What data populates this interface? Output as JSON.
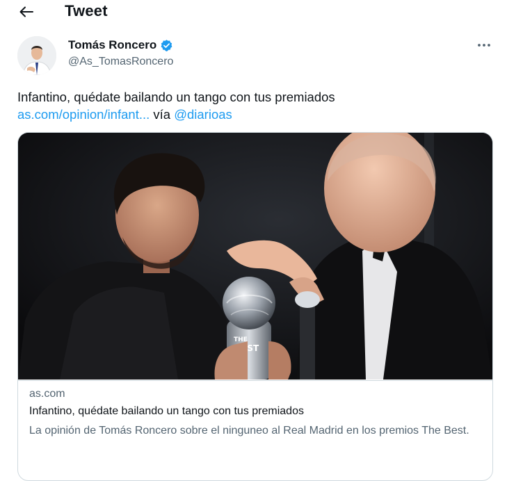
{
  "header": {
    "title": "Tweet",
    "back_icon": "arrow-left-icon"
  },
  "author": {
    "name": "Tomás Roncero",
    "handle": "@As_TomasRoncero",
    "verified": true,
    "verified_icon": "verified-badge-icon",
    "verified_color": "#1d9bf0"
  },
  "more_icon": "more-horizontal-icon",
  "tweet": {
    "text": "Infantino, quédate bailando un tango con tus premiados",
    "link_text": "as.com/opinion/infant...",
    "via_text": " vía ",
    "mention": "@diarioas",
    "link_color": "#1d9bf0"
  },
  "card": {
    "image_alt": "Infantino presenting The Best trophy to Messi",
    "domain": "as.com",
    "title": "Infantino, quédate bailando un tango con tus premiados",
    "description": "La opinión de Tomás Roncero sobre el ninguneo al Real Madrid en los premios The Best."
  }
}
